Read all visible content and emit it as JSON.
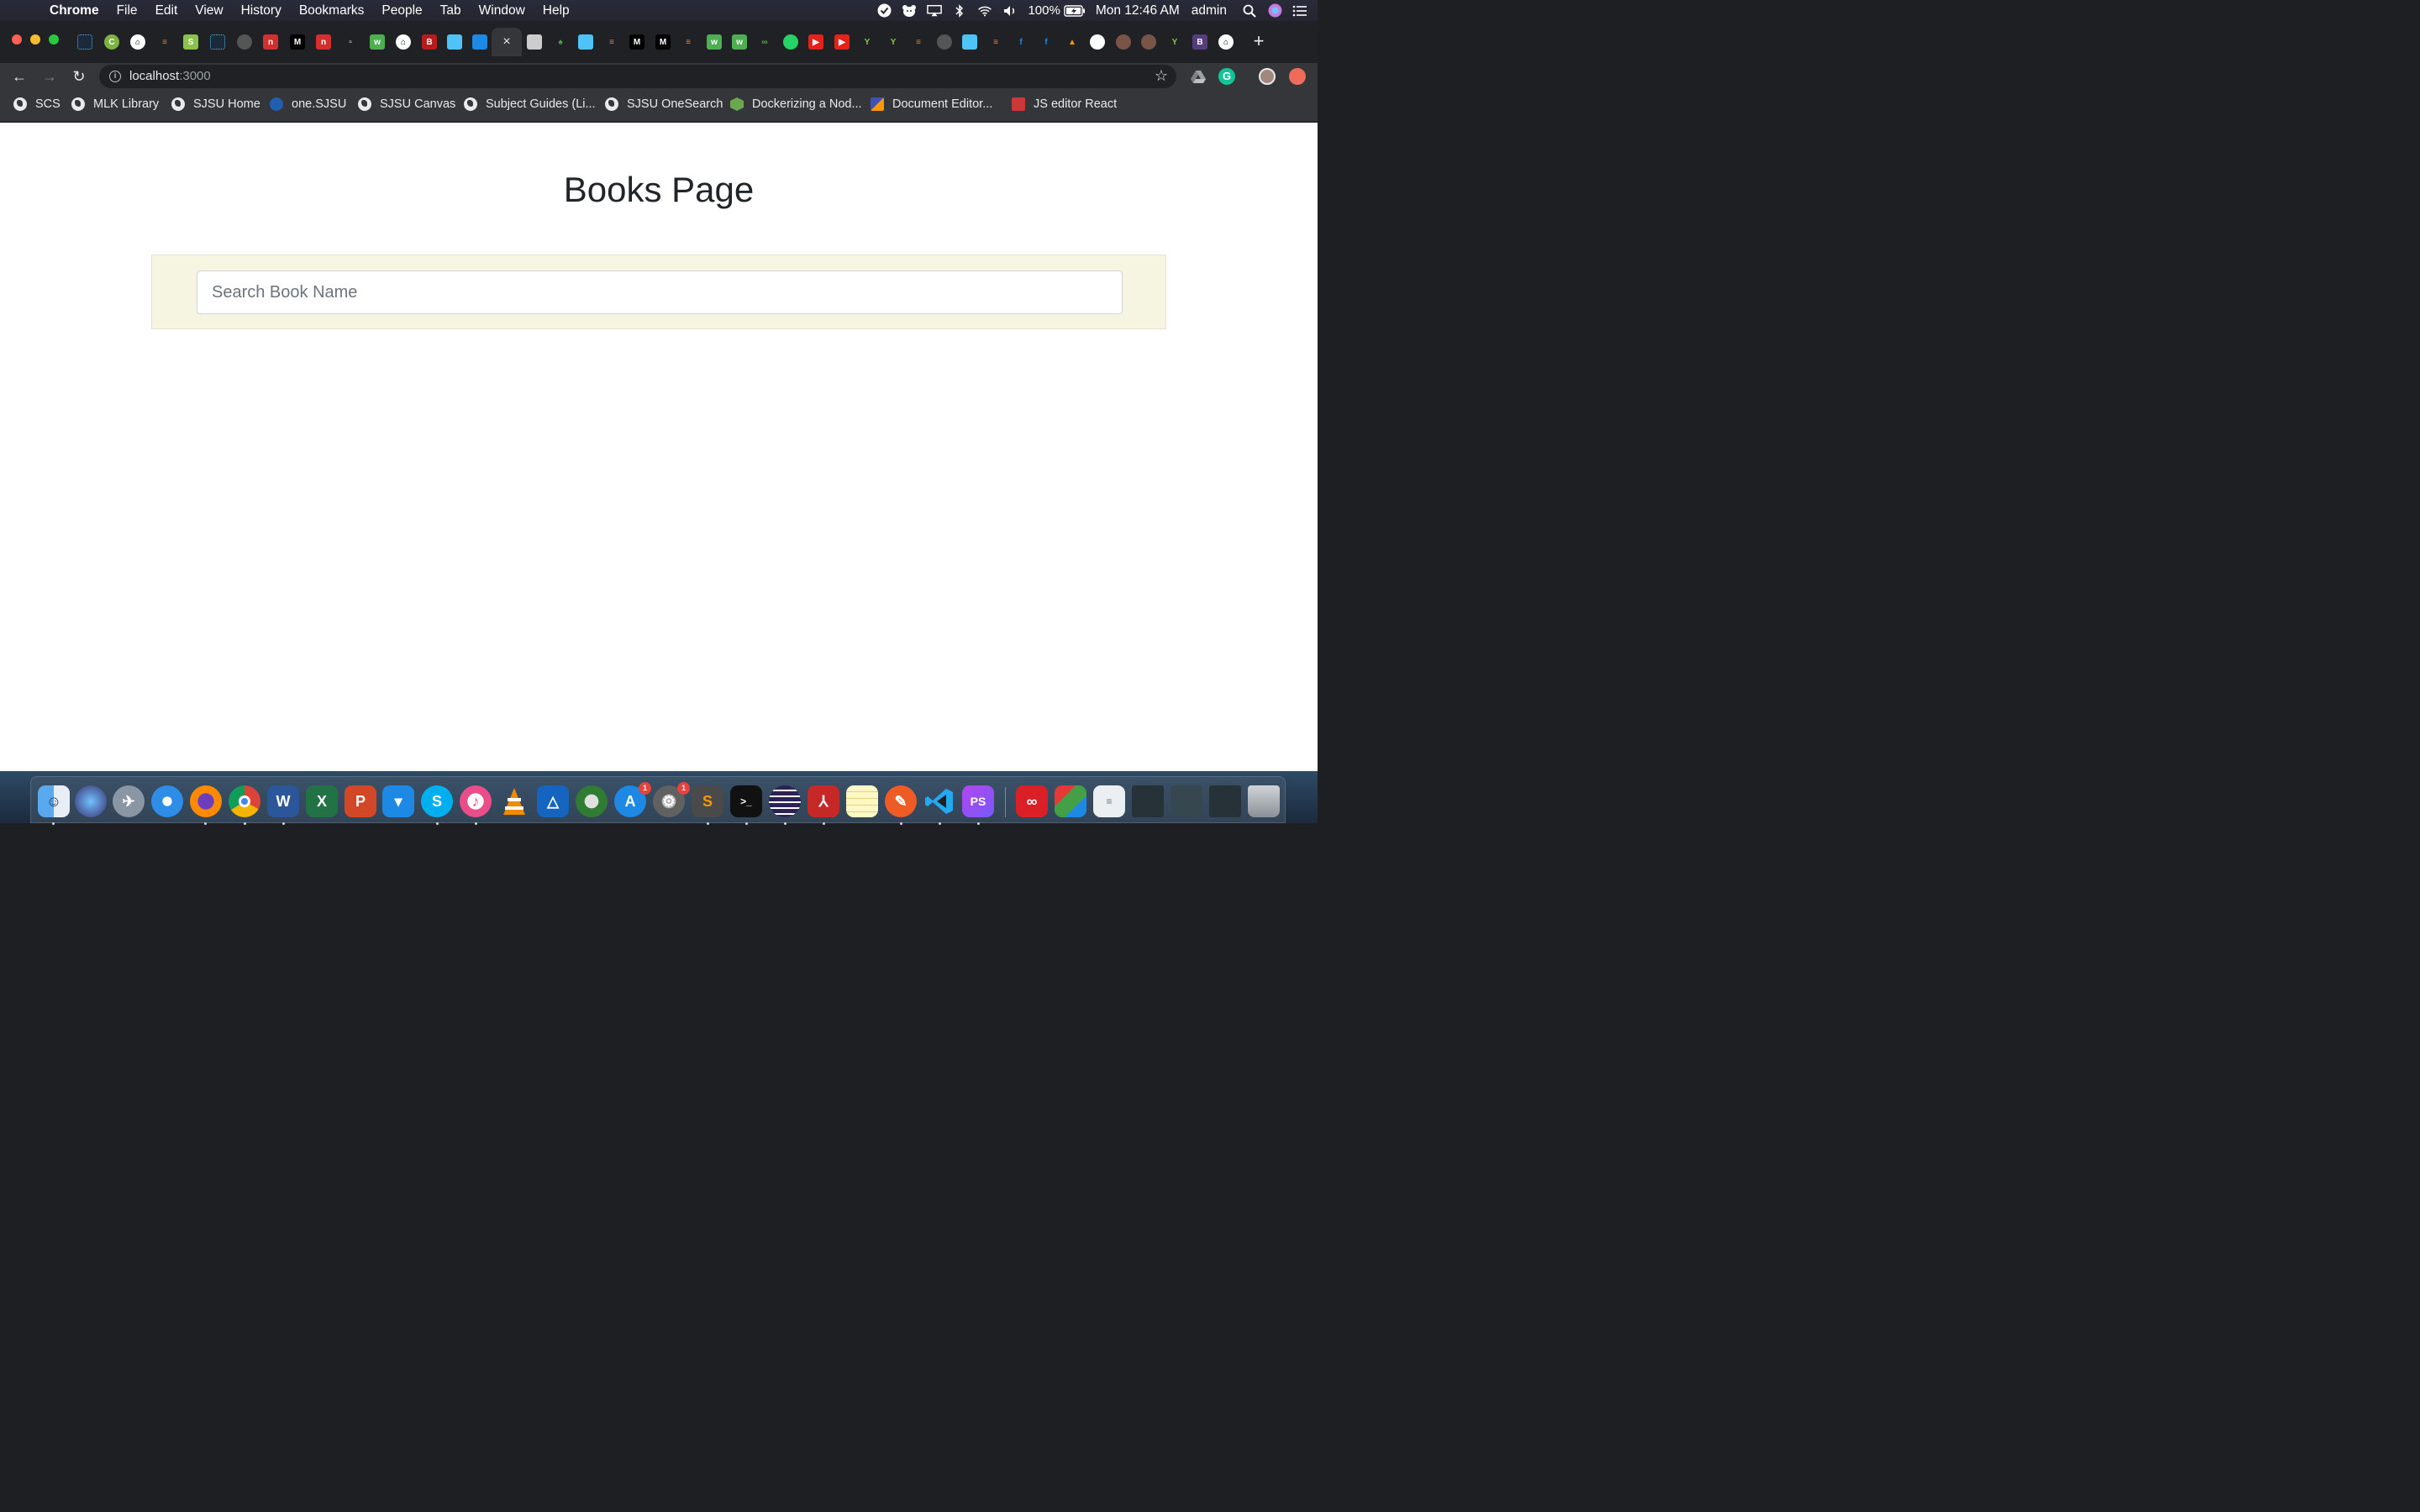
{
  "menubar": {
    "app_name": "Chrome",
    "menus": [
      "File",
      "Edit",
      "View",
      "History",
      "Bookmarks",
      "People",
      "Tab",
      "Window",
      "Help"
    ],
    "battery": "100%",
    "clock": "Mon 12:46 AM",
    "user": "admin"
  },
  "browser": {
    "active_tab_close": "×",
    "url_host": "localhost",
    "url_port": ":3000"
  },
  "bookmarks": [
    {
      "label": "SCS"
    },
    {
      "label": "MLK Library"
    },
    {
      "label": "SJSU Home"
    },
    {
      "label": "one.SJSU"
    },
    {
      "label": "SJSU Canvas"
    },
    {
      "label": "Subject Guides (Li..."
    },
    {
      "label": "SJSU OneSearch"
    },
    {
      "label": "Dockerizing a Nod..."
    },
    {
      "label": "Document Editor..."
    },
    {
      "label": "JS editor React"
    }
  ],
  "page": {
    "title": "Books Page",
    "search_placeholder": "Search Book Name",
    "search_value": ""
  },
  "dock": {
    "badges": {
      "app_store": "1",
      "system_preferences": "1"
    }
  },
  "colors": {
    "search_panel_bg": "#f5f5e1",
    "page_bg": "#ffffff",
    "title_color": "#212529"
  }
}
